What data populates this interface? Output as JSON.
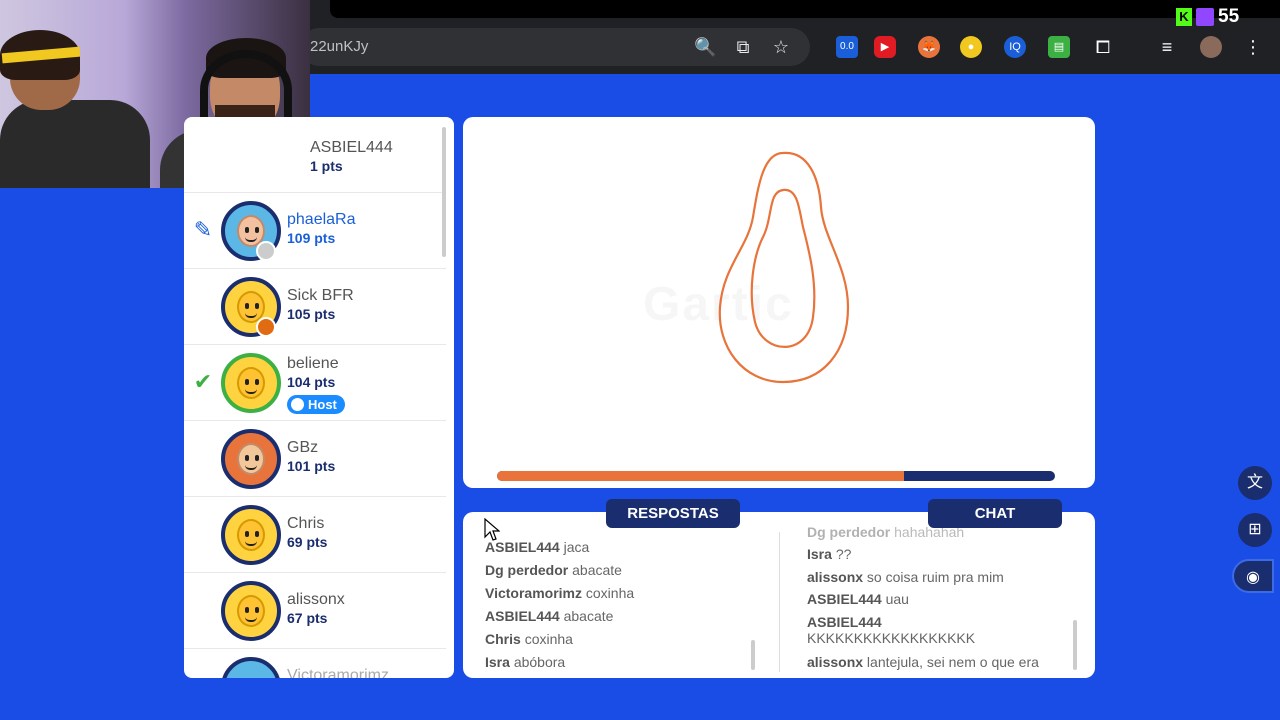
{
  "browser": {
    "url_fragment": "22unKJy",
    "stream_viewers": "55"
  },
  "players": [
    {
      "name": "ASBIEL444",
      "points": "1 pts",
      "partial": true
    },
    {
      "name": "phaelaRa",
      "points": "109 pts",
      "drawing": true
    },
    {
      "name": "Sick BFR",
      "points": "105 pts"
    },
    {
      "name": "beliene",
      "points": "104 pts",
      "guessed": true,
      "host_label": "Host"
    },
    {
      "name": "GBz",
      "points": "101 pts"
    },
    {
      "name": "Chris",
      "points": "69 pts"
    },
    {
      "name": "alissonx",
      "points": "67 pts"
    },
    {
      "name": "Victoramorimz",
      "points": "",
      "partial": true
    }
  ],
  "canvas": {
    "watermark": "Gartic",
    "timer_progress": 0.73,
    "stroke_color": "#e8743b"
  },
  "tabs": {
    "answers_label": "RESPOSTAS",
    "chat_label": "CHAT"
  },
  "answers": [
    {
      "user": "ASBIEL444",
      "text": "jaca"
    },
    {
      "user": "Dg perdedor",
      "text": "abacate"
    },
    {
      "user": "Victoramorimz",
      "text": "coxinha"
    },
    {
      "user": "ASBIEL444",
      "text": "abacate"
    },
    {
      "user": "Chris",
      "text": "coxinha"
    },
    {
      "user": "Isra",
      "text": "abóbora"
    }
  ],
  "chat": [
    {
      "user": "Dg perdedor",
      "text": "hahahahah"
    },
    {
      "user": "Isra",
      "text": "??"
    },
    {
      "user": "alissonx",
      "text": "so coisa ruim pra mim"
    },
    {
      "user": "ASBIEL444",
      "text": "uau"
    },
    {
      "user": "ASBIEL444",
      "text": "KKKKKKKKKKKKKKKKKK"
    },
    {
      "user": "alissonx",
      "text": "lantejula, sei nem o que era"
    }
  ],
  "colors": {
    "background": "#1a4de6",
    "navy": "#1a2d6e",
    "accent_orange": "#e8743b",
    "active_blue": "#1a5fd9",
    "check_green": "#3cb043"
  }
}
